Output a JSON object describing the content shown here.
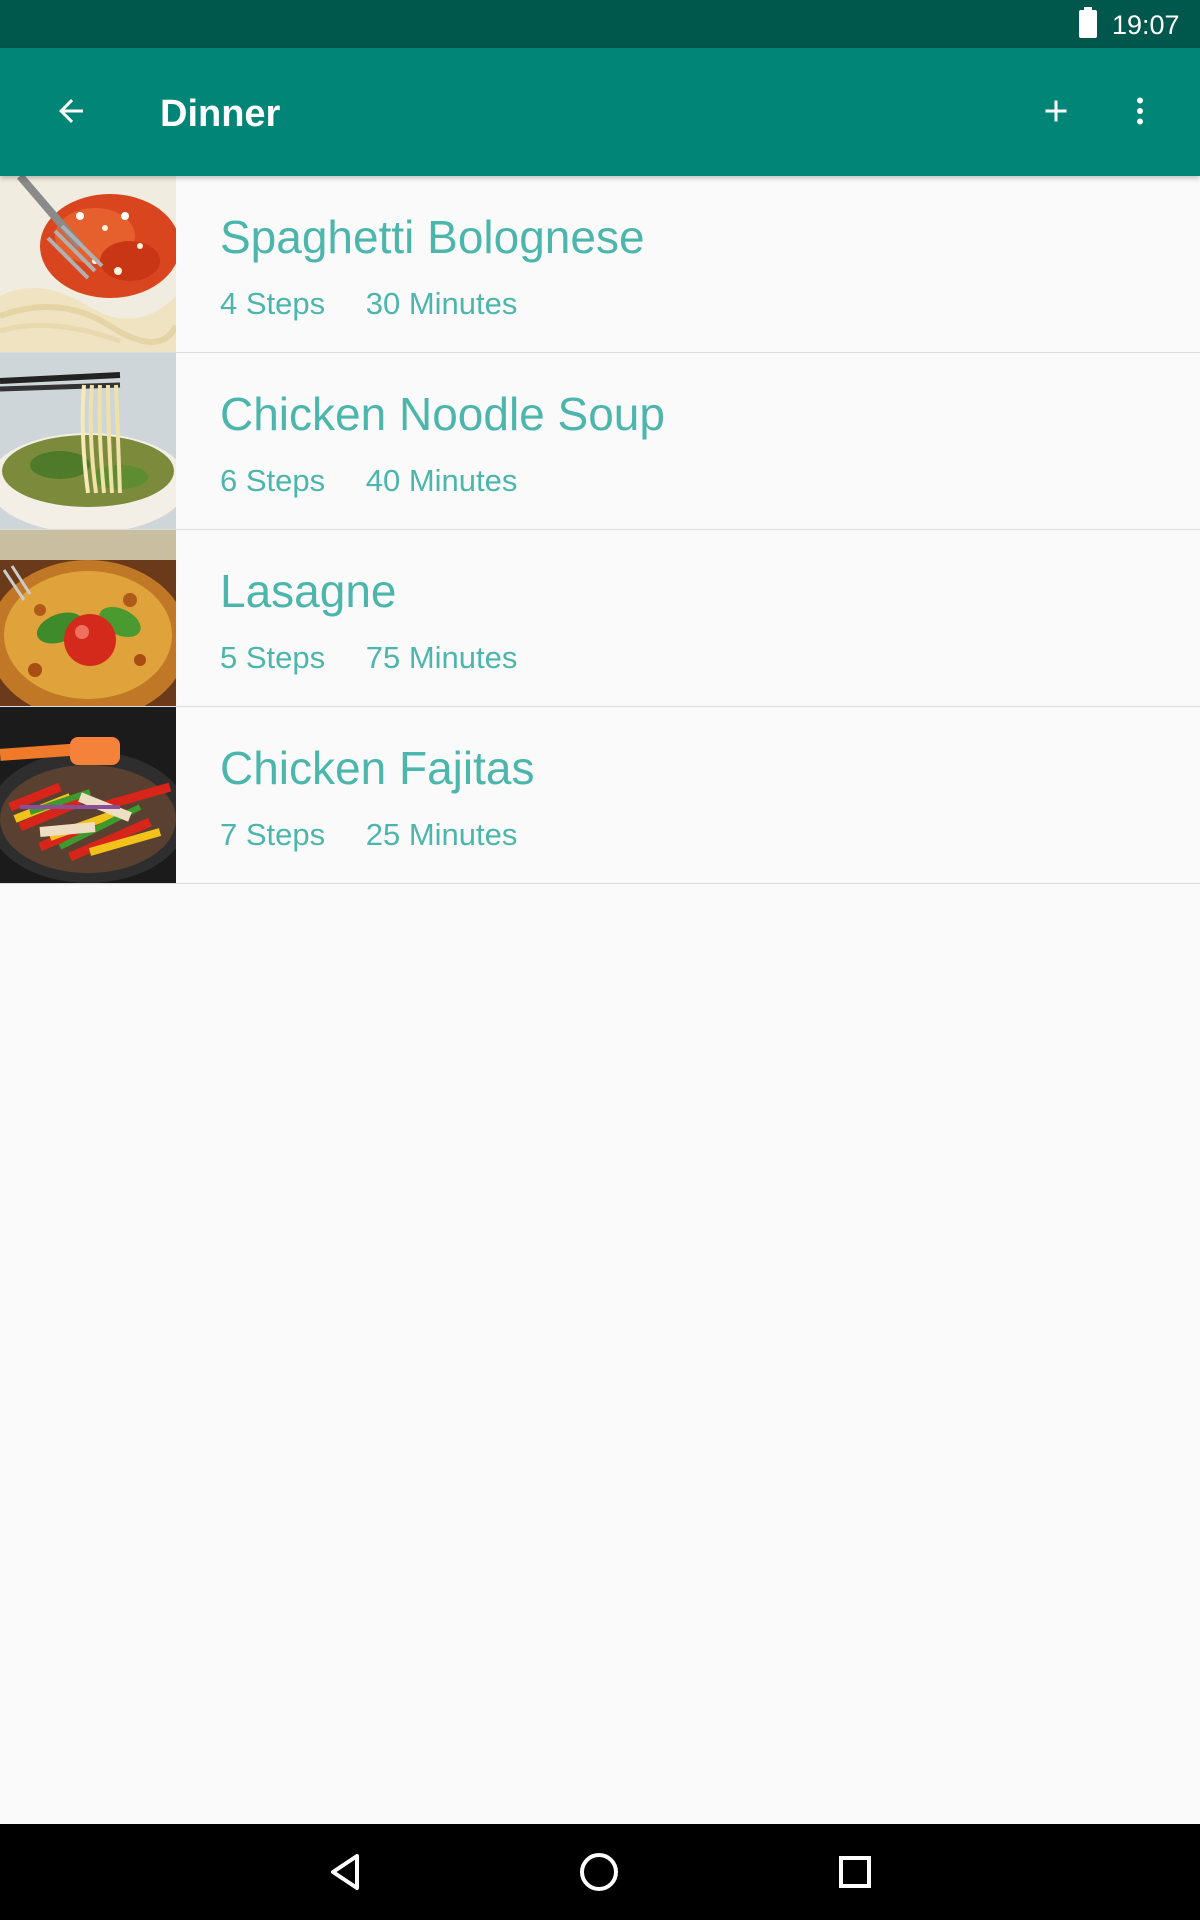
{
  "status_bar": {
    "time": "19:07",
    "battery_icon": "battery-full-icon"
  },
  "toolbar": {
    "title": "Dinner",
    "back_icon": "arrow-back-icon",
    "add_icon": "plus-icon",
    "more_icon": "more-vert-icon"
  },
  "recipes": [
    {
      "title": "Spaghetti Bolognese",
      "steps": "4 Steps",
      "time": "30 Minutes"
    },
    {
      "title": "Chicken Noodle Soup",
      "steps": "6 Steps",
      "time": "40 Minutes"
    },
    {
      "title": "Lasagne",
      "steps": "5 Steps",
      "time": "75 Minutes"
    },
    {
      "title": "Chicken Fajitas",
      "steps": "7 Steps",
      "time": "25 Minutes"
    }
  ],
  "nav_bar": {
    "back_icon": "nav-back-icon",
    "home_icon": "nav-home-icon",
    "recents_icon": "nav-recents-icon"
  },
  "colors": {
    "status_bar": "#00574b",
    "app_bar": "#008577",
    "accent_text": "#4db6ac",
    "background": "#fafafa"
  }
}
